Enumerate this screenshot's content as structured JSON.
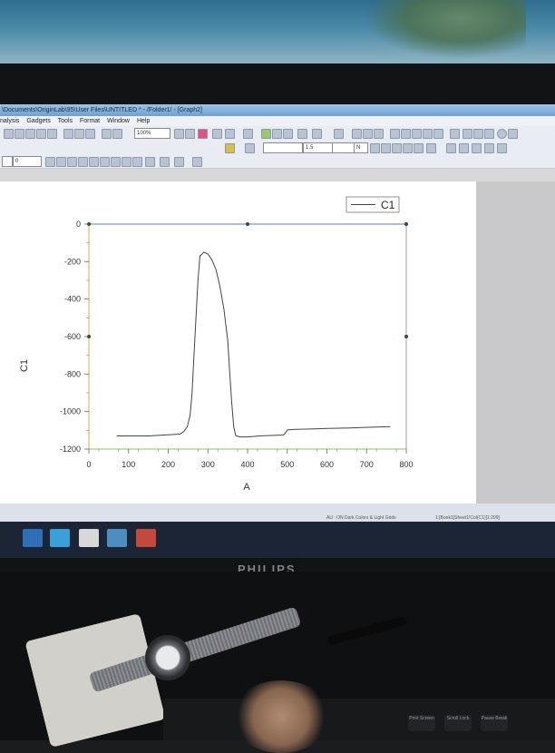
{
  "window": {
    "title": "\\Documents\\OriginLab\\95\\User Files\\UNTITLED * - /Folder1/ - [Graph2]"
  },
  "menu": {
    "items": [
      "nalysis",
      "Gadgets",
      "Tools",
      "Format",
      "Window",
      "Help"
    ]
  },
  "toolbar": {
    "zoom": "100%",
    "line_width": "1.5",
    "font_size": "0",
    "color_field": "N"
  },
  "status": {
    "text": "AU : ON   Dark Colors & Light Grids",
    "book": "1:[Book1]Sheet1!Col(C1)[1:209]"
  },
  "monitor": {
    "brand": "PHILIPS"
  },
  "keyboard": {
    "keys": [
      "Print Screen",
      "Scroll Lock",
      "Pause Break"
    ]
  },
  "chart_data": {
    "type": "line",
    "xlabel": "A",
    "ylabel": "C1",
    "xlim": [
      0,
      800
    ],
    "ylim": [
      -1200,
      0
    ],
    "xticks": [
      0,
      100,
      200,
      300,
      400,
      500,
      600,
      700,
      800
    ],
    "yticks": [
      0,
      -200,
      -400,
      -600,
      -800,
      -1000,
      -1200
    ],
    "legend": {
      "position": "top-right"
    },
    "grid": false,
    "series": [
      {
        "name": "C1",
        "color": "#444444",
        "x": [
          70,
          150,
          230,
          240,
          248,
          255,
          260,
          265,
          270,
          275,
          280,
          290,
          300,
          310,
          320,
          330,
          340,
          350,
          355,
          360,
          365,
          370,
          380,
          400,
          430,
          450,
          490,
          495,
          500,
          520,
          560,
          600,
          640,
          680,
          720,
          760
        ],
        "y": [
          -1130,
          -1130,
          -1120,
          -1105,
          -1080,
          -1020,
          -900,
          -700,
          -500,
          -300,
          -170,
          -150,
          -160,
          -190,
          -240,
          -330,
          -450,
          -620,
          -790,
          -950,
          -1080,
          -1128,
          -1135,
          -1135,
          -1130,
          -1128,
          -1125,
          -1115,
          -1098,
          -1095,
          -1093,
          -1090,
          -1088,
          -1086,
          -1083,
          -1080
        ]
      }
    ]
  }
}
